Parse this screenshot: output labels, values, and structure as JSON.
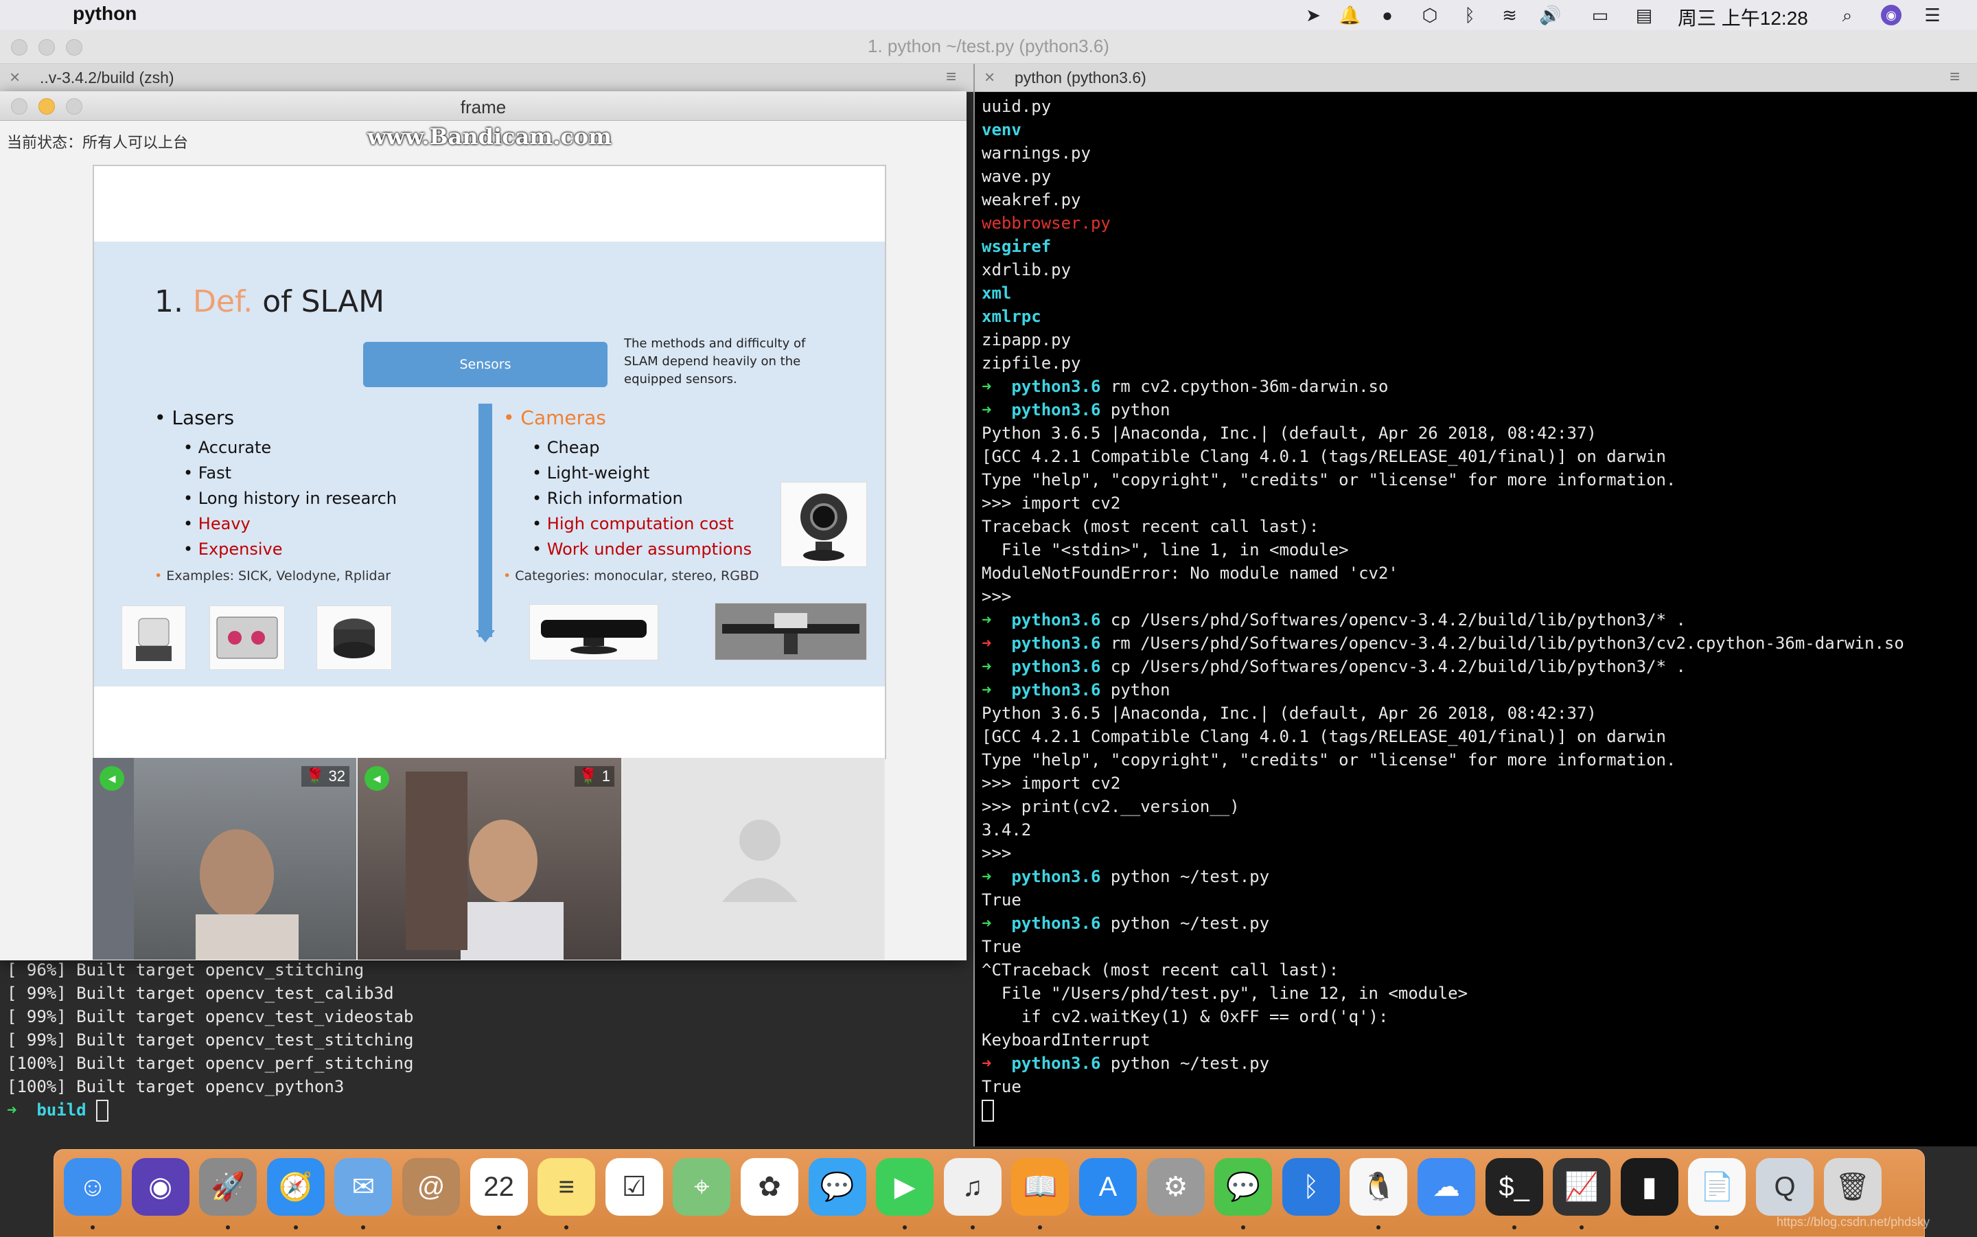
{
  "menubar": {
    "app_name": "python",
    "clock": "周三 上午12:28",
    "icons": [
      "paper-plane-icon",
      "bell-icon",
      "wechat-icon",
      "box-icon",
      "bluetooth-icon",
      "wifi-icon",
      "volume-icon",
      "battery-icon",
      "flag-icon",
      "search-icon",
      "siri-icon",
      "list-icon"
    ]
  },
  "iterm": {
    "window_title": "1. python ~/test.py (python3.6)",
    "left_tab": "..v-3.4.2/build (zsh)",
    "right_tab": "python (python3.6)"
  },
  "frame": {
    "title": "frame",
    "status": "当前状态：所有人可以上台",
    "watermark": "www.Bandicam.com",
    "slide": {
      "title_num": "1.",
      "title_hl": "Def.",
      "title_rest": "of SLAM",
      "sensors": "Sensors",
      "note": "The methods and difficulty of SLAM depend heavily on the equipped sensors.",
      "lasers": {
        "head": "Lasers",
        "items": [
          {
            "text": "Accurate",
            "red": false
          },
          {
            "text": "Fast",
            "red": false
          },
          {
            "text": "Long history in research",
            "red": false
          },
          {
            "text": "Heavy",
            "red": true
          },
          {
            "text": "Expensive",
            "red": true
          }
        ],
        "examples": "Examples: SICK, Velodyne, Rplidar"
      },
      "cameras": {
        "head": "Cameras",
        "items": [
          {
            "text": "Cheap",
            "red": false
          },
          {
            "text": "Light-weight",
            "red": false
          },
          {
            "text": "Rich information",
            "red": false
          },
          {
            "text": "High computation cost",
            "red": true
          },
          {
            "text": "Work under assumptions",
            "red": true
          }
        ],
        "categories": "Categories: monocular, stereo, RGBD"
      }
    },
    "video": [
      {
        "count": "32"
      },
      {
        "count": "1"
      }
    ]
  },
  "left_term": {
    "lines": [
      "[ 96%] Built target opencv_stitching",
      "[ 99%] Built target opencv_test_calib3d",
      "[ 99%] Built target opencv_test_videostab",
      "[ 99%] Built target opencv_test_stitching",
      "[100%] Built target opencv_perf_stitching",
      "[100%] Built target opencv_python3"
    ],
    "prompt_dir": "build"
  },
  "right_term": {
    "lines": [
      {
        "t": "uuid.py",
        "k": "plain"
      },
      {
        "t": "venv",
        "k": "cyan"
      },
      {
        "t": "warnings.py",
        "k": "plain"
      },
      {
        "t": "wave.py",
        "k": "plain"
      },
      {
        "t": "weakref.py",
        "k": "plain"
      },
      {
        "t": "webbrowser.py",
        "k": "red"
      },
      {
        "t": "wsgiref",
        "k": "cyan"
      },
      {
        "t": "xdrlib.py",
        "k": "plain"
      },
      {
        "t": "xml",
        "k": "cyan"
      },
      {
        "t": "xmlrpc",
        "k": "cyan"
      },
      {
        "t": "zipapp.py",
        "k": "plain"
      },
      {
        "t": "zipfile.py",
        "k": "plain"
      },
      {
        "t": "rm cv2.cpython-36m-darwin.so",
        "k": "prompt-g",
        "d": "python3.6"
      },
      {
        "t": "python",
        "k": "prompt-g",
        "d": "python3.6"
      },
      {
        "t": "Python 3.6.5 |Anaconda, Inc.| (default, Apr 26 2018, 08:42:37)",
        "k": "plain"
      },
      {
        "t": "[GCC 4.2.1 Compatible Clang 4.0.1 (tags/RELEASE_401/final)] on darwin",
        "k": "plain"
      },
      {
        "t": "Type \"help\", \"copyright\", \"credits\" or \"license\" for more information.",
        "k": "plain"
      },
      {
        "t": ">>> import cv2",
        "k": "plain"
      },
      {
        "t": "Traceback (most recent call last):",
        "k": "plain"
      },
      {
        "t": "  File \"<stdin>\", line 1, in <module>",
        "k": "plain"
      },
      {
        "t": "ModuleNotFoundError: No module named 'cv2'",
        "k": "plain"
      },
      {
        "t": ">>>",
        "k": "plain"
      },
      {
        "t": "cp /Users/phd/Softwares/opencv-3.4.2/build/lib/python3/* .",
        "k": "prompt-g",
        "d": "python3.6"
      },
      {
        "t": "rm /Users/phd/Softwares/opencv-3.4.2/build/lib/python3/cv2.cpython-36m-darwin.so",
        "k": "prompt-r",
        "d": "python3.6"
      },
      {
        "t": "cp /Users/phd/Softwares/opencv-3.4.2/build/lib/python3/* .",
        "k": "prompt-g",
        "d": "python3.6"
      },
      {
        "t": "python",
        "k": "prompt-g",
        "d": "python3.6"
      },
      {
        "t": "Python 3.6.5 |Anaconda, Inc.| (default, Apr 26 2018, 08:42:37)",
        "k": "plain"
      },
      {
        "t": "[GCC 4.2.1 Compatible Clang 4.0.1 (tags/RELEASE_401/final)] on darwin",
        "k": "plain"
      },
      {
        "t": "Type \"help\", \"copyright\", \"credits\" or \"license\" for more information.",
        "k": "plain"
      },
      {
        "t": ">>> import cv2",
        "k": "plain"
      },
      {
        "t": ">>> print(cv2.__version__)",
        "k": "plain"
      },
      {
        "t": "3.4.2",
        "k": "plain"
      },
      {
        "t": ">>>",
        "k": "plain"
      },
      {
        "t": "python ~/test.py",
        "k": "prompt-g",
        "d": "python3.6"
      },
      {
        "t": "True",
        "k": "plain"
      },
      {
        "t": "python ~/test.py",
        "k": "prompt-g",
        "d": "python3.6"
      },
      {
        "t": "True",
        "k": "plain"
      },
      {
        "t": "^CTraceback (most recent call last):",
        "k": "plain"
      },
      {
        "t": "  File \"/Users/phd/test.py\", line 12, in <module>",
        "k": "plain"
      },
      {
        "t": "    if cv2.waitKey(1) & 0xFF == ord('q'):",
        "k": "plain"
      },
      {
        "t": "KeyboardInterrupt",
        "k": "plain"
      },
      {
        "t": "python ~/test.py",
        "k": "prompt-r",
        "d": "python3.6"
      },
      {
        "t": "True",
        "k": "plain"
      }
    ]
  },
  "dock": {
    "apps": [
      {
        "name": "finder",
        "glyph": "☺",
        "bg": "#3d8ff0"
      },
      {
        "name": "siri",
        "glyph": "◉",
        "bg": "#5a3fb5"
      },
      {
        "name": "launchpad",
        "glyph": "🚀",
        "bg": "#8a8a8a"
      },
      {
        "name": "safari",
        "glyph": "🧭",
        "bg": "#2f8ff2"
      },
      {
        "name": "mail",
        "glyph": "✉",
        "bg": "#6aa8e8"
      },
      {
        "name": "contacts",
        "glyph": "@",
        "bg": "#b8875a"
      },
      {
        "name": "calendar",
        "glyph": "22",
        "bg": "#ffffff"
      },
      {
        "name": "notes",
        "glyph": "≡",
        "bg": "#fbe27a"
      },
      {
        "name": "reminders",
        "glyph": "☑",
        "bg": "#ffffff"
      },
      {
        "name": "maps",
        "glyph": "⌖",
        "bg": "#7cc47a"
      },
      {
        "name": "photos",
        "glyph": "✿",
        "bg": "#ffffff"
      },
      {
        "name": "messages",
        "glyph": "💬",
        "bg": "#37a4f4"
      },
      {
        "name": "facetime",
        "glyph": "▶",
        "bg": "#3ecf5a"
      },
      {
        "name": "itunes",
        "glyph": "♫",
        "bg": "#f0f0f0"
      },
      {
        "name": "ibooks",
        "glyph": "📖",
        "bg": "#f59a2a"
      },
      {
        "name": "app-store",
        "glyph": "A",
        "bg": "#2a8af2"
      },
      {
        "name": "system-preferences",
        "glyph": "⚙",
        "bg": "#9a9a9a"
      },
      {
        "name": "wechat",
        "glyph": "💬",
        "bg": "#4cc34a"
      },
      {
        "name": "bluetooth",
        "glyph": "ᛒ",
        "bg": "#2a7ae0"
      },
      {
        "name": "qq",
        "glyph": "🐧",
        "bg": "#f6f6f6"
      },
      {
        "name": "baidu-netdisk",
        "glyph": "☁",
        "bg": "#3e8cf4"
      },
      {
        "name": "terminal",
        "glyph": "$_",
        "bg": "#222222"
      },
      {
        "name": "activity-monitor",
        "glyph": "📈",
        "bg": "#333333"
      },
      {
        "name": "piano",
        "glyph": "▮",
        "bg": "#1a1a1a"
      },
      {
        "name": "document",
        "glyph": "📄",
        "bg": "#f8f8f8"
      },
      {
        "name": "quicktime",
        "glyph": "Q",
        "bg": "#cfd6de"
      },
      {
        "name": "trash",
        "glyph": "🗑",
        "bg": "#d8d8d8"
      }
    ]
  },
  "blog_url": "https://blog.csdn.net/phdsky"
}
